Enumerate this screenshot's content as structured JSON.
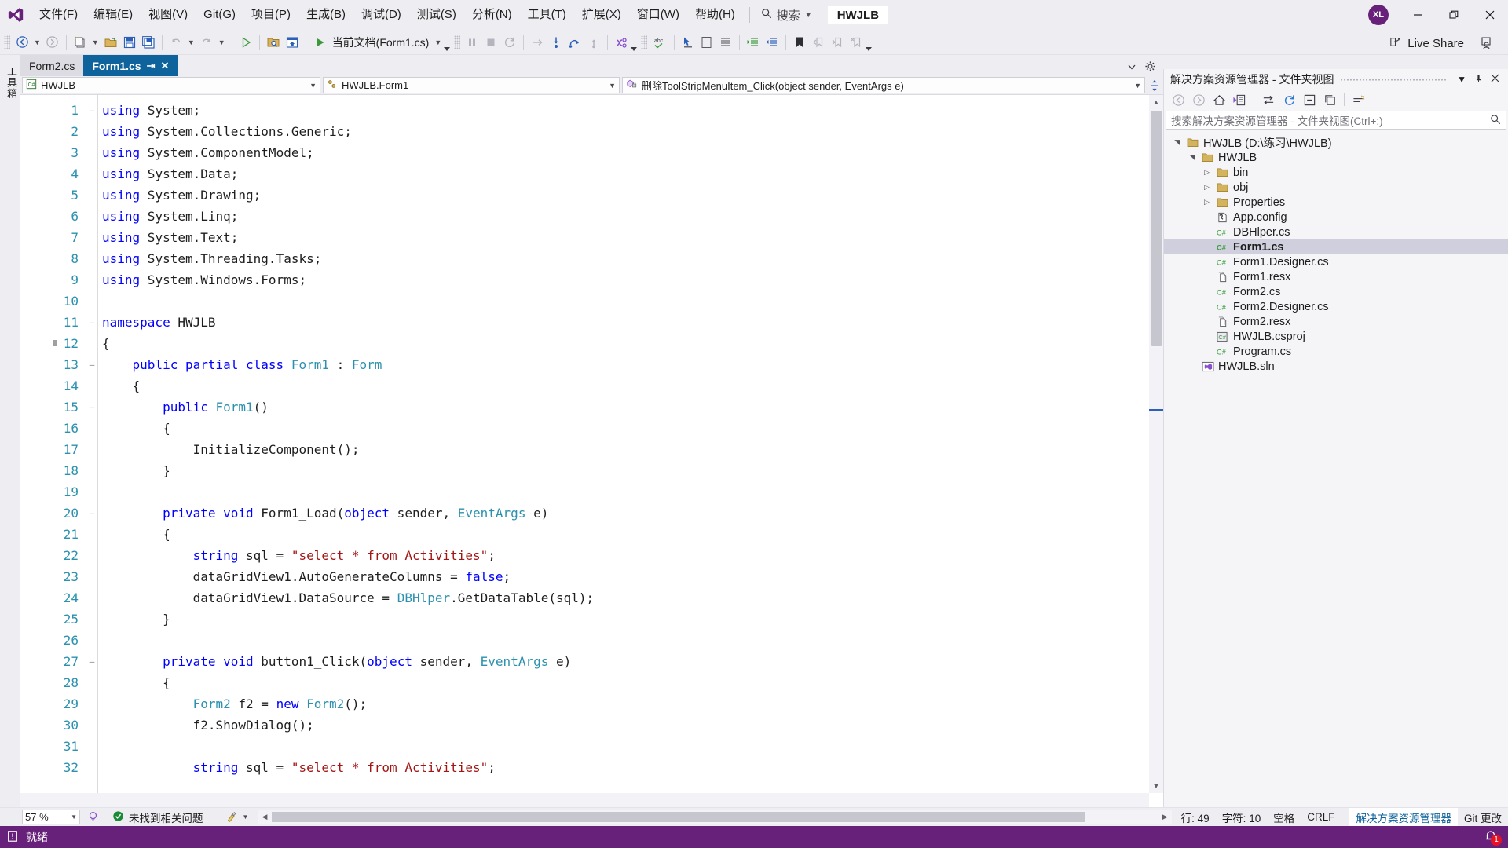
{
  "app": {
    "logo_icon": "visual-studio-logo",
    "project_chip": "HWJLB",
    "avatar_initials": "XL"
  },
  "menu": {
    "items": [
      {
        "label": "文件(F)"
      },
      {
        "label": "编辑(E)"
      },
      {
        "label": "视图(V)"
      },
      {
        "label": "Git(G)"
      },
      {
        "label": "项目(P)"
      },
      {
        "label": "生成(B)"
      },
      {
        "label": "调试(D)"
      },
      {
        "label": "测试(S)"
      },
      {
        "label": "分析(N)"
      },
      {
        "label": "工具(T)"
      },
      {
        "label": "扩展(X)"
      },
      {
        "label": "窗口(W)"
      },
      {
        "label": "帮助(H)"
      }
    ],
    "search_label": "搜索"
  },
  "window_controls": {
    "minimize": "–",
    "restore": "❐",
    "close": "✕"
  },
  "toolbar": {
    "run_target": "当前文档(Form1.cs)",
    "live_share": "Live Share"
  },
  "left_rail": {
    "toolbox_label": "工具箱"
  },
  "tabs": [
    {
      "label": "Form2.cs",
      "active": false
    },
    {
      "label": "Form1.cs",
      "active": true
    }
  ],
  "navbar": {
    "project": "HWJLB",
    "type": "HWJLB.Form1",
    "member": "删除ToolStripMenuItem_Click(object sender, EventArgs e)"
  },
  "editor": {
    "lines": [
      {
        "n": "1",
        "fold": "–",
        "tokens": [
          {
            "t": "using",
            "c": "kw"
          },
          {
            "t": " System;",
            "c": ""
          }
        ]
      },
      {
        "n": "2",
        "fold": "",
        "tokens": [
          {
            "t": "using",
            "c": "kw"
          },
          {
            "t": " System.Collections.Generic;",
            "c": ""
          }
        ]
      },
      {
        "n": "3",
        "fold": "",
        "tokens": [
          {
            "t": "using",
            "c": "kw"
          },
          {
            "t": " System.ComponentModel;",
            "c": ""
          }
        ]
      },
      {
        "n": "4",
        "fold": "",
        "tokens": [
          {
            "t": "using",
            "c": "kw"
          },
          {
            "t": " System.Data;",
            "c": ""
          }
        ]
      },
      {
        "n": "5",
        "fold": "",
        "tokens": [
          {
            "t": "using",
            "c": "kw"
          },
          {
            "t": " System.Drawing;",
            "c": ""
          }
        ]
      },
      {
        "n": "6",
        "fold": "",
        "tokens": [
          {
            "t": "using",
            "c": "kw"
          },
          {
            "t": " System.Linq;",
            "c": ""
          }
        ]
      },
      {
        "n": "7",
        "fold": "",
        "tokens": [
          {
            "t": "using",
            "c": "kw"
          },
          {
            "t": " System.Text;",
            "c": ""
          }
        ]
      },
      {
        "n": "8",
        "fold": "",
        "tokens": [
          {
            "t": "using",
            "c": "kw"
          },
          {
            "t": " System.Threading.Tasks;",
            "c": ""
          }
        ]
      },
      {
        "n": "9",
        "fold": "",
        "tokens": [
          {
            "t": "using",
            "c": "kw"
          },
          {
            "t": " System.Windows.Forms;",
            "c": ""
          }
        ]
      },
      {
        "n": "10",
        "fold": "",
        "tokens": []
      },
      {
        "n": "11",
        "fold": "–",
        "tokens": [
          {
            "t": "namespace",
            "c": "kw"
          },
          {
            "t": " HWJLB",
            "c": ""
          }
        ]
      },
      {
        "n": "12",
        "fold": "",
        "tokens": [
          {
            "t": "{",
            "c": ""
          }
        ]
      },
      {
        "n": "13",
        "fold": "–",
        "tokens": [
          {
            "t": "    ",
            "c": ""
          },
          {
            "t": "public partial class",
            "c": "kw"
          },
          {
            "t": " ",
            "c": ""
          },
          {
            "t": "Form1",
            "c": "typ"
          },
          {
            "t": " : ",
            "c": ""
          },
          {
            "t": "Form",
            "c": "typ"
          }
        ]
      },
      {
        "n": "14",
        "fold": "",
        "tokens": [
          {
            "t": "    {",
            "c": ""
          }
        ]
      },
      {
        "n": "15",
        "fold": "–",
        "tokens": [
          {
            "t": "        ",
            "c": ""
          },
          {
            "t": "public",
            "c": "kw"
          },
          {
            "t": " ",
            "c": ""
          },
          {
            "t": "Form1",
            "c": "typ"
          },
          {
            "t": "()",
            "c": ""
          }
        ]
      },
      {
        "n": "16",
        "fold": "",
        "tokens": [
          {
            "t": "        {",
            "c": ""
          }
        ]
      },
      {
        "n": "17",
        "fold": "",
        "tokens": [
          {
            "t": "            InitializeComponent();",
            "c": ""
          }
        ]
      },
      {
        "n": "18",
        "fold": "",
        "tokens": [
          {
            "t": "        }",
            "c": ""
          }
        ]
      },
      {
        "n": "19",
        "fold": "",
        "tokens": []
      },
      {
        "n": "20",
        "fold": "–",
        "tokens": [
          {
            "t": "        ",
            "c": ""
          },
          {
            "t": "private void",
            "c": "kw"
          },
          {
            "t": " Form1_Load(",
            "c": ""
          },
          {
            "t": "object",
            "c": "kw"
          },
          {
            "t": " sender, ",
            "c": ""
          },
          {
            "t": "EventArgs",
            "c": "typ"
          },
          {
            "t": " e)",
            "c": ""
          }
        ]
      },
      {
        "n": "21",
        "fold": "",
        "tokens": [
          {
            "t": "        {",
            "c": ""
          }
        ]
      },
      {
        "n": "22",
        "fold": "",
        "tokens": [
          {
            "t": "            ",
            "c": ""
          },
          {
            "t": "string",
            "c": "kw"
          },
          {
            "t": " sql = ",
            "c": ""
          },
          {
            "t": "\"select * from Activities\"",
            "c": "str"
          },
          {
            "t": ";",
            "c": ""
          }
        ]
      },
      {
        "n": "23",
        "fold": "",
        "tokens": [
          {
            "t": "            dataGridView1.AutoGenerateColumns = ",
            "c": ""
          },
          {
            "t": "false",
            "c": "kw"
          },
          {
            "t": ";",
            "c": ""
          }
        ]
      },
      {
        "n": "24",
        "fold": "",
        "tokens": [
          {
            "t": "            dataGridView1.DataSource = ",
            "c": ""
          },
          {
            "t": "DBHlper",
            "c": "typ"
          },
          {
            "t": ".GetDataTable(sql);",
            "c": ""
          }
        ]
      },
      {
        "n": "25",
        "fold": "",
        "tokens": [
          {
            "t": "        }",
            "c": ""
          }
        ]
      },
      {
        "n": "26",
        "fold": "",
        "tokens": []
      },
      {
        "n": "27",
        "fold": "–",
        "tokens": [
          {
            "t": "        ",
            "c": ""
          },
          {
            "t": "private void",
            "c": "kw"
          },
          {
            "t": " button1_Click(",
            "c": ""
          },
          {
            "t": "object",
            "c": "kw"
          },
          {
            "t": " sender, ",
            "c": ""
          },
          {
            "t": "EventArgs",
            "c": "typ"
          },
          {
            "t": " e)",
            "c": ""
          }
        ]
      },
      {
        "n": "28",
        "fold": "",
        "tokens": [
          {
            "t": "        {",
            "c": ""
          }
        ]
      },
      {
        "n": "29",
        "fold": "",
        "tokens": [
          {
            "t": "            ",
            "c": ""
          },
          {
            "t": "Form2",
            "c": "typ"
          },
          {
            "t": " f2 = ",
            "c": ""
          },
          {
            "t": "new",
            "c": "kw"
          },
          {
            "t": " ",
            "c": ""
          },
          {
            "t": "Form2",
            "c": "typ"
          },
          {
            "t": "();",
            "c": ""
          }
        ]
      },
      {
        "n": "30",
        "fold": "",
        "tokens": [
          {
            "t": "            f2.ShowDialog();",
            "c": ""
          }
        ]
      },
      {
        "n": "31",
        "fold": "",
        "tokens": []
      },
      {
        "n": "32",
        "fold": "",
        "tokens": [
          {
            "t": "            ",
            "c": ""
          },
          {
            "t": "string",
            "c": "kw"
          },
          {
            "t": " sql = ",
            "c": ""
          },
          {
            "t": "\"select * from Activities\"",
            "c": "str"
          },
          {
            "t": ";",
            "c": ""
          }
        ]
      }
    ]
  },
  "solution_explorer": {
    "title": "解决方案资源管理器 - 文件夹视图",
    "search_placeholder": "搜索解决方案资源管理器 - 文件夹视图(Ctrl+;)",
    "tree": [
      {
        "label": "HWJLB (D:\\练习\\HWJLB)",
        "indent": 0,
        "twist": "▾",
        "icon": "folder",
        "selected": false
      },
      {
        "label": "HWJLB",
        "indent": 1,
        "twist": "▾",
        "icon": "folder",
        "selected": false
      },
      {
        "label": "bin",
        "indent": 2,
        "twist": "▸",
        "icon": "folder",
        "selected": false
      },
      {
        "label": "obj",
        "indent": 2,
        "twist": "▸",
        "icon": "folder",
        "selected": false
      },
      {
        "label": "Properties",
        "indent": 2,
        "twist": "▸",
        "icon": "folder",
        "selected": false
      },
      {
        "label": "App.config",
        "indent": 2,
        "twist": "",
        "icon": "config",
        "selected": false
      },
      {
        "label": "DBHlper.cs",
        "indent": 2,
        "twist": "",
        "icon": "csharp",
        "selected": false
      },
      {
        "label": "Form1.cs",
        "indent": 2,
        "twist": "",
        "icon": "csharp",
        "selected": true
      },
      {
        "label": "Form1.Designer.cs",
        "indent": 2,
        "twist": "",
        "icon": "csharp",
        "selected": false
      },
      {
        "label": "Form1.resx",
        "indent": 2,
        "twist": "",
        "icon": "resx",
        "selected": false
      },
      {
        "label": "Form2.cs",
        "indent": 2,
        "twist": "",
        "icon": "csharp",
        "selected": false
      },
      {
        "label": "Form2.Designer.cs",
        "indent": 2,
        "twist": "",
        "icon": "csharp",
        "selected": false
      },
      {
        "label": "Form2.resx",
        "indent": 2,
        "twist": "",
        "icon": "resx",
        "selected": false
      },
      {
        "label": "HWJLB.csproj",
        "indent": 2,
        "twist": "",
        "icon": "csproj",
        "selected": false
      },
      {
        "label": "Program.cs",
        "indent": 2,
        "twist": "",
        "icon": "csharp",
        "selected": false
      },
      {
        "label": "HWJLB.sln",
        "indent": 1,
        "twist": "",
        "icon": "sln",
        "selected": false
      }
    ]
  },
  "editor_status": {
    "zoom": "57 %",
    "issues": "未找到相关问题",
    "line": "行: 49",
    "char": "字符: 10",
    "spaces": "空格",
    "eol": "CRLF",
    "pane_tabs": [
      {
        "label": "解决方案资源管理器",
        "active": true
      },
      {
        "label": "Git 更改",
        "active": false
      }
    ]
  },
  "status_bar": {
    "state": "就绪",
    "notification_count": "1"
  },
  "colors": {
    "accent_purple": "#68217a",
    "tab_active_blue": "#0e639c",
    "keyword_blue": "#0000ff",
    "type_teal": "#2b91af",
    "string_red": "#a31515",
    "linenum_teal": "#2b91af",
    "badge_red": "#e81123"
  }
}
